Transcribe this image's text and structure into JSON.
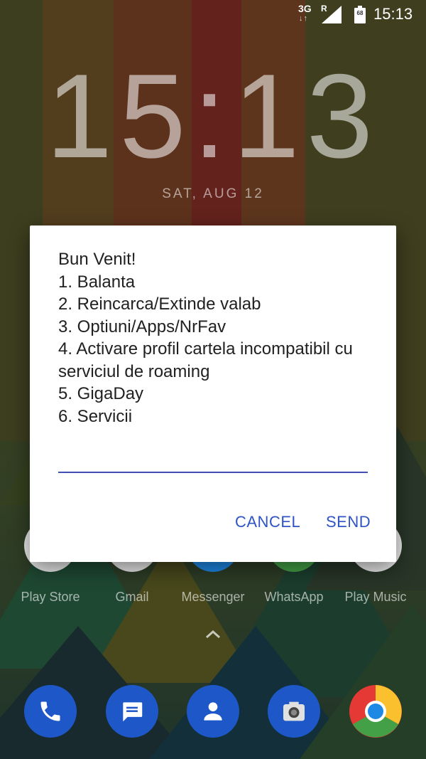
{
  "status_bar": {
    "network": "3G",
    "data_arrows": "↓↑",
    "roaming": "R",
    "battery_level": "68",
    "time": "15:13"
  },
  "lock_clock": {
    "time": "15:13",
    "date": "SAT, AUG 12"
  },
  "home_apps": [
    {
      "label": "Play Store",
      "icon": "play-store-icon"
    },
    {
      "label": "Gmail",
      "icon": "gmail-icon"
    },
    {
      "label": "Messenger",
      "icon": "messenger-icon"
    },
    {
      "label": "WhatsApp",
      "icon": "whatsapp-icon"
    },
    {
      "label": "Play Music",
      "icon": "play-music-icon"
    }
  ],
  "dock": [
    {
      "icon": "phone-icon",
      "color": "#1e58c8"
    },
    {
      "icon": "messages-icon",
      "color": "#1e58c8"
    },
    {
      "icon": "contacts-icon",
      "color": "#1e58c8"
    },
    {
      "icon": "camera-icon",
      "color": "#1e58c8"
    },
    {
      "icon": "chrome-icon",
      "color": "#e53935"
    }
  ],
  "dialog": {
    "lines": [
      "Bun Venit!",
      "1. Balanta",
      "2. Reincarca/Extinde valab",
      "3. Optiuni/Apps/NrFav",
      "4. Activare profil cartela incompatibil cu serviciul de roaming",
      "5. GigaDay",
      "6. Servicii"
    ],
    "input_value": "",
    "cancel_label": "CANCEL",
    "send_label": "SEND",
    "accent_color": "#3f51b5"
  }
}
